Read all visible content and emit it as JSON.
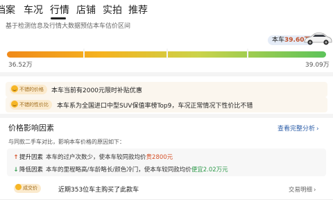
{
  "tabs": [
    {
      "label": "档案"
    },
    {
      "label": "车况"
    },
    {
      "label": "行情"
    },
    {
      "label": "店铺"
    },
    {
      "label": "实拍"
    },
    {
      "label": "推荐"
    }
  ],
  "valuation": {
    "subtitle": "基于检测信息及行情大数据预估本车估价区间",
    "price_prefix": "本车",
    "price_value": "39.60万",
    "range_min": "36.52万",
    "range_max": "39.09万"
  },
  "highlights": [
    {
      "badge": "不错的价格",
      "text": "本车当前有2000元限时补贴优惠"
    },
    {
      "badge": "不错的性价比",
      "text": "本车系为全国进口中型SUV保值率榜Top9，车况正常情况下性价比不错"
    }
  ],
  "factors_section": {
    "title": "价格影响因素",
    "link": "查看完整分析",
    "description": "与同款二手车对比，影响本车价格的原因如下：",
    "items": [
      {
        "name": "提升因素",
        "pre": "本车的过户次数少，使本车较同款均价",
        "value": "贵2800元",
        "direction": "up"
      },
      {
        "name": "降低因素",
        "pre": "本车的里程略高/车龄略长/颜色冷门，使本车较同款均价",
        "value": "便宜2.02万元",
        "direction": "down"
      }
    ]
  },
  "deal": {
    "badge": "成交价",
    "text": "近期353位车主购买了此款车",
    "link": "交易明细"
  },
  "colors": {
    "accent_orange": "#f08a1a",
    "accent_green": "#5dc35a",
    "price_red": "#c1522c",
    "link_blue": "#2d5ea8"
  }
}
